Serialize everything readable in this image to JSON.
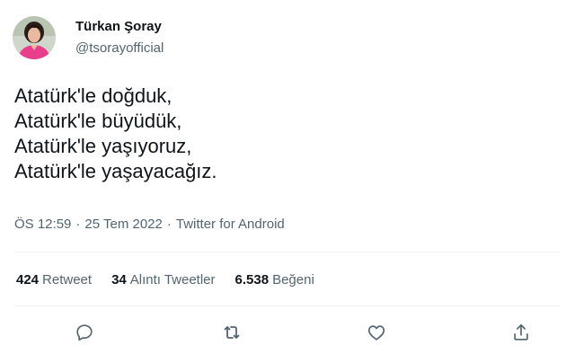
{
  "author": {
    "display_name": "Türkan Şoray",
    "handle": "@tsorayofficial",
    "avatar_icon": "profile-photo"
  },
  "tweet": {
    "lines": [
      "Atatürk'le doğduk,",
      "Atatürk'le büyüdük,",
      "Atatürk'le yaşıyoruz,",
      "Atatürk'le yaşayacağız."
    ]
  },
  "meta": {
    "time": "ÖS 12:59",
    "separator": "·",
    "date": "25 Tem 2022",
    "source": "Twitter for Android"
  },
  "stats": {
    "retweets": {
      "count": "424",
      "label": "Retweet"
    },
    "quotes": {
      "count": "34",
      "label": "Alıntı Tweetler"
    },
    "likes": {
      "count": "6.538",
      "label": "Beğeni"
    }
  },
  "actions": {
    "reply_icon": "reply-icon",
    "retweet_icon": "retweet-icon",
    "like_icon": "heart-icon",
    "share_icon": "share-icon"
  },
  "colors": {
    "text_primary": "#0f1419",
    "text_secondary": "#536471",
    "divider": "#eff3f4",
    "avatar_accent": "#e83e8c"
  }
}
